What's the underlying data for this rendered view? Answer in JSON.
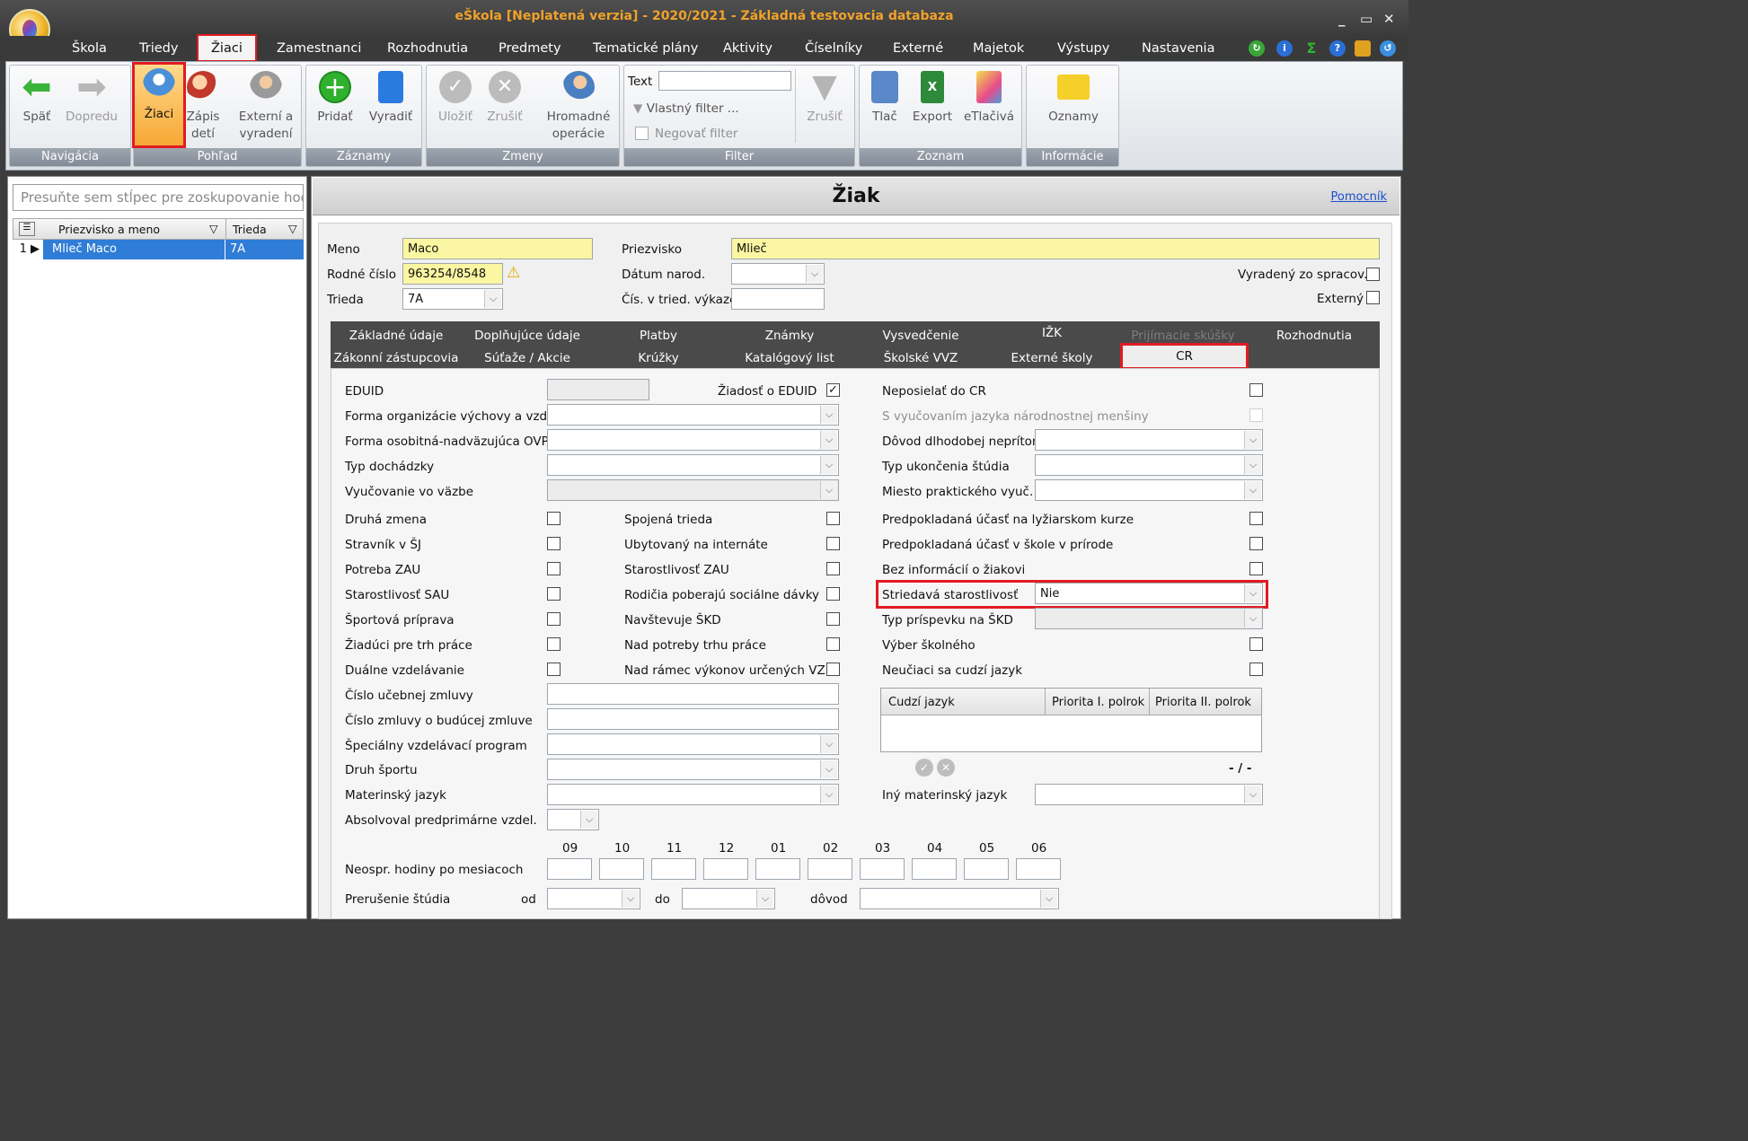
{
  "window": {
    "title": "eŠkola [Neplatená verzia] - 2020/2021 - Základná testovacia databaza",
    "controls": [
      "_",
      "▭",
      "✕"
    ]
  },
  "menu": [
    "Škola",
    "Triedy",
    "Žiaci",
    "Zamestnanci",
    "Rozhodnutia",
    "Predmety",
    "Tematické plány",
    "Aktivity",
    "Číselníky",
    "Externé",
    "Majetok",
    "Výstupy",
    "Nastavenia"
  ],
  "ribbon": {
    "nav": {
      "back": "Späť",
      "forward": "Dopredu",
      "group": "Navigácia"
    },
    "view": {
      "students": "Žiaci",
      "enroll": "Zápis detí",
      "external": "Externí a vyradení",
      "group": "Pohľad"
    },
    "records": {
      "add": "Pridať",
      "remove": "Vyradiť",
      "group": "Záznamy"
    },
    "changes": {
      "save": "Uložiť",
      "cancel": "Zrušiť",
      "bulk": "Hromadné operácie",
      "group": "Zmeny"
    },
    "filter": {
      "text_label": "Text",
      "custom": "Vlastný filter ...",
      "negate": "Negovať filter",
      "clear": "Zrušiť",
      "group": "Filter"
    },
    "list": {
      "print": "Tlač",
      "export": "Export",
      "eprint": "eTlačivá",
      "group": "Zoznam"
    },
    "info": {
      "notices": "Oznamy",
      "group": "Informácie"
    }
  },
  "sidebar": {
    "group_placeholder": "Presuňte sem stĺpec pre zoskupovanie hodnôt",
    "columns": [
      "Priezvisko a meno",
      "Trieda"
    ],
    "rows": [
      {
        "num": "1",
        "name": "Mlieč Maco",
        "class": "7A"
      }
    ]
  },
  "main": {
    "title": "Žiak",
    "help": "Pomocník",
    "meno_label": "Meno",
    "meno": "Maco",
    "priezvisko_label": "Priezvisko",
    "priezvisko": "Mlieč",
    "rc_label": "Rodné číslo",
    "rc": "963254/8548",
    "datum_label": "Dátum narod.",
    "vyradeny_label": "Vyradený zo spracov.",
    "trieda_label": "Trieda",
    "trieda": "7A",
    "cis_label": "Čís. v tried. výkaze",
    "externy_label": "Externý"
  },
  "tabs_row1": [
    "Základné údaje",
    "Doplňujúce údaje",
    "Platby",
    "Známky",
    "Vysvedčenie",
    "IŽK",
    "Prijímacie skúšky",
    "Rozhodnutia"
  ],
  "tabs_row2": [
    "Zákonní zástupcovia",
    "Súťaže / Akcie",
    "Krúžky",
    "Katalógový list",
    "Školské VVZ",
    "Externé školy",
    "CR"
  ],
  "cr": {
    "eduid": "EDUID",
    "ziadost_eduid": "Žiadosť o EDUID",
    "neposielat": "Neposielať do CR",
    "forma_org": "Forma organizácie výchovy a vzdel.",
    "jazyk_mensiny": "S vyučovaním jazyka národnostnej menšiny",
    "forma_osob": "Forma osobitná-nadväzujúca OVP",
    "dovod_nepritom": "Dôvod dlhodobej neprítom.",
    "typ_dochadzky": "Typ dochádzky",
    "typ_ukoncenia": "Typ ukončenia štúdia",
    "vyucovanie_vazbe": "Vyučovanie vo väzbe",
    "miesto_prakt": "Miesto praktického vyuč.",
    "col1": [
      "Druhá zmena",
      "Stravník v ŠJ",
      "Potreba ZAU",
      "Starostlivosť SAU",
      "Športová príprava",
      "Žiadúci pre trh práce",
      "Duálne vzdelávanie"
    ],
    "col2": [
      "Spojená trieda",
      "Ubytovaný na internáte",
      "Starostlivosť ZAU",
      "Rodičia poberajú sociálne dávky",
      "Navštevuje ŠKD",
      "Nad potreby trhu práce",
      "Nad rámec výkonov určených VZN"
    ],
    "col3": [
      "Predpokladaná účasť na lyžiarskom kurze",
      "Predpokladaná účasť v škole v prírode",
      "Bez informácií o žiakovi"
    ],
    "striedava_label": "Striedavá starostlivosť",
    "striedava_value": "Nie",
    "typ_prispevku": "Typ príspevku na ŠKD",
    "vyber_skolneho": "Výber školného",
    "neuciaci": "Neučiaci sa cudzí jazyk",
    "cislo_ucebnej": "Číslo učebnej zmluvy",
    "cislo_buducej": "Číslo zmluvy o budúcej zmluve",
    "specialny": "Špeciálny vzdelávací program",
    "druh_sportu": "Druh športu",
    "materinsky": "Materinský jazyk",
    "iny_materinsky": "Iný materinský jazyk",
    "absolvoval": "Absolvoval predprimárne vzdel.",
    "lang_columns": [
      "Cudzí jazyk",
      "Priorita I. polrok",
      "Priorita II. polrok"
    ],
    "pager": "- / -",
    "months": [
      "09",
      "10",
      "11",
      "12",
      "01",
      "02",
      "03",
      "04",
      "05",
      "06"
    ],
    "neospr": "Neospr. hodiny po mesiacoch",
    "prerusenie": "Prerušenie štúdia",
    "od": "od",
    "do": "do",
    "dovod": "dôvod"
  }
}
